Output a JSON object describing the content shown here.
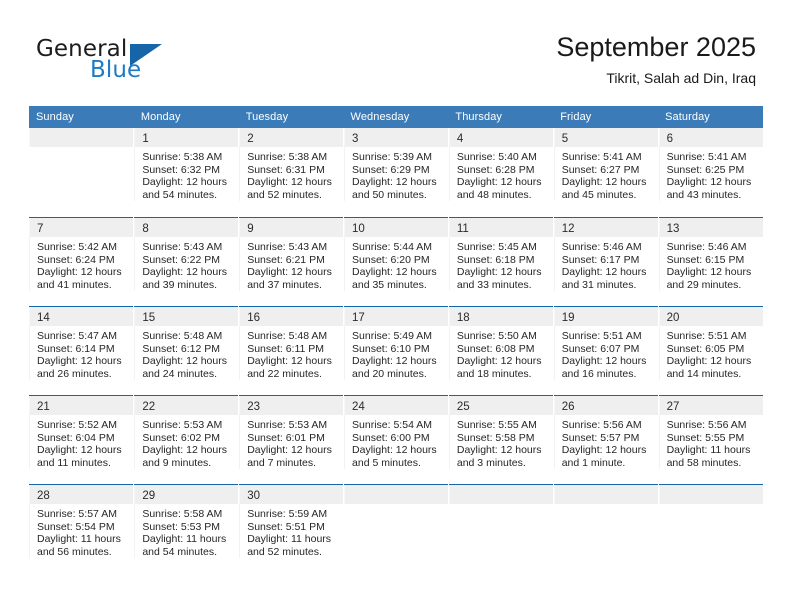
{
  "brand": {
    "name_part1": "General",
    "name_part2": "Blue",
    "logo_icon": "triangle-icon"
  },
  "header": {
    "month_title": "September 2025",
    "location": "Tikrit, Salah ad Din, Iraq"
  },
  "colors": {
    "header_blue": "#3b7cb8",
    "accent_blue": "#1565a8",
    "brand_blue": "#1f7ac4",
    "band_gray": "#efefef"
  },
  "weekday_headers": [
    "Sunday",
    "Monday",
    "Tuesday",
    "Wednesday",
    "Thursday",
    "Friday",
    "Saturday"
  ],
  "labels": {
    "sunrise_prefix": "Sunrise: ",
    "sunset_prefix": "Sunset: ",
    "daylight_prefix": "Daylight: "
  },
  "weeks": [
    [
      {
        "day": "",
        "sunrise": "",
        "sunset": "",
        "daylight": "",
        "empty": true
      },
      {
        "day": "1",
        "sunrise": "Sunrise: 5:38 AM",
        "sunset": "Sunset: 6:32 PM",
        "daylight": "Daylight: 12 hours and 54 minutes."
      },
      {
        "day": "2",
        "sunrise": "Sunrise: 5:38 AM",
        "sunset": "Sunset: 6:31 PM",
        "daylight": "Daylight: 12 hours and 52 minutes."
      },
      {
        "day": "3",
        "sunrise": "Sunrise: 5:39 AM",
        "sunset": "Sunset: 6:29 PM",
        "daylight": "Daylight: 12 hours and 50 minutes."
      },
      {
        "day": "4",
        "sunrise": "Sunrise: 5:40 AM",
        "sunset": "Sunset: 6:28 PM",
        "daylight": "Daylight: 12 hours and 48 minutes."
      },
      {
        "day": "5",
        "sunrise": "Sunrise: 5:41 AM",
        "sunset": "Sunset: 6:27 PM",
        "daylight": "Daylight: 12 hours and 45 minutes."
      },
      {
        "day": "6",
        "sunrise": "Sunrise: 5:41 AM",
        "sunset": "Sunset: 6:25 PM",
        "daylight": "Daylight: 12 hours and 43 minutes."
      }
    ],
    [
      {
        "day": "7",
        "sunrise": "Sunrise: 5:42 AM",
        "sunset": "Sunset: 6:24 PM",
        "daylight": "Daylight: 12 hours and 41 minutes."
      },
      {
        "day": "8",
        "sunrise": "Sunrise: 5:43 AM",
        "sunset": "Sunset: 6:22 PM",
        "daylight": "Daylight: 12 hours and 39 minutes."
      },
      {
        "day": "9",
        "sunrise": "Sunrise: 5:43 AM",
        "sunset": "Sunset: 6:21 PM",
        "daylight": "Daylight: 12 hours and 37 minutes."
      },
      {
        "day": "10",
        "sunrise": "Sunrise: 5:44 AM",
        "sunset": "Sunset: 6:20 PM",
        "daylight": "Daylight: 12 hours and 35 minutes."
      },
      {
        "day": "11",
        "sunrise": "Sunrise: 5:45 AM",
        "sunset": "Sunset: 6:18 PM",
        "daylight": "Daylight: 12 hours and 33 minutes."
      },
      {
        "day": "12",
        "sunrise": "Sunrise: 5:46 AM",
        "sunset": "Sunset: 6:17 PM",
        "daylight": "Daylight: 12 hours and 31 minutes."
      },
      {
        "day": "13",
        "sunrise": "Sunrise: 5:46 AM",
        "sunset": "Sunset: 6:15 PM",
        "daylight": "Daylight: 12 hours and 29 minutes."
      }
    ],
    [
      {
        "day": "14",
        "sunrise": "Sunrise: 5:47 AM",
        "sunset": "Sunset: 6:14 PM",
        "daylight": "Daylight: 12 hours and 26 minutes."
      },
      {
        "day": "15",
        "sunrise": "Sunrise: 5:48 AM",
        "sunset": "Sunset: 6:12 PM",
        "daylight": "Daylight: 12 hours and 24 minutes."
      },
      {
        "day": "16",
        "sunrise": "Sunrise: 5:48 AM",
        "sunset": "Sunset: 6:11 PM",
        "daylight": "Daylight: 12 hours and 22 minutes."
      },
      {
        "day": "17",
        "sunrise": "Sunrise: 5:49 AM",
        "sunset": "Sunset: 6:10 PM",
        "daylight": "Daylight: 12 hours and 20 minutes."
      },
      {
        "day": "18",
        "sunrise": "Sunrise: 5:50 AM",
        "sunset": "Sunset: 6:08 PM",
        "daylight": "Daylight: 12 hours and 18 minutes."
      },
      {
        "day": "19",
        "sunrise": "Sunrise: 5:51 AM",
        "sunset": "Sunset: 6:07 PM",
        "daylight": "Daylight: 12 hours and 16 minutes."
      },
      {
        "day": "20",
        "sunrise": "Sunrise: 5:51 AM",
        "sunset": "Sunset: 6:05 PM",
        "daylight": "Daylight: 12 hours and 14 minutes."
      }
    ],
    [
      {
        "day": "21",
        "sunrise": "Sunrise: 5:52 AM",
        "sunset": "Sunset: 6:04 PM",
        "daylight": "Daylight: 12 hours and 11 minutes."
      },
      {
        "day": "22",
        "sunrise": "Sunrise: 5:53 AM",
        "sunset": "Sunset: 6:02 PM",
        "daylight": "Daylight: 12 hours and 9 minutes."
      },
      {
        "day": "23",
        "sunrise": "Sunrise: 5:53 AM",
        "sunset": "Sunset: 6:01 PM",
        "daylight": "Daylight: 12 hours and 7 minutes."
      },
      {
        "day": "24",
        "sunrise": "Sunrise: 5:54 AM",
        "sunset": "Sunset: 6:00 PM",
        "daylight": "Daylight: 12 hours and 5 minutes."
      },
      {
        "day": "25",
        "sunrise": "Sunrise: 5:55 AM",
        "sunset": "Sunset: 5:58 PM",
        "daylight": "Daylight: 12 hours and 3 minutes."
      },
      {
        "day": "26",
        "sunrise": "Sunrise: 5:56 AM",
        "sunset": "Sunset: 5:57 PM",
        "daylight": "Daylight: 12 hours and 1 minute."
      },
      {
        "day": "27",
        "sunrise": "Sunrise: 5:56 AM",
        "sunset": "Sunset: 5:55 PM",
        "daylight": "Daylight: 11 hours and 58 minutes."
      }
    ],
    [
      {
        "day": "28",
        "sunrise": "Sunrise: 5:57 AM",
        "sunset": "Sunset: 5:54 PM",
        "daylight": "Daylight: 11 hours and 56 minutes."
      },
      {
        "day": "29",
        "sunrise": "Sunrise: 5:58 AM",
        "sunset": "Sunset: 5:53 PM",
        "daylight": "Daylight: 11 hours and 54 minutes."
      },
      {
        "day": "30",
        "sunrise": "Sunrise: 5:59 AM",
        "sunset": "Sunset: 5:51 PM",
        "daylight": "Daylight: 11 hours and 52 minutes."
      },
      {
        "day": "",
        "sunrise": "",
        "sunset": "",
        "daylight": "",
        "empty": true
      },
      {
        "day": "",
        "sunrise": "",
        "sunset": "",
        "daylight": "",
        "empty": true
      },
      {
        "day": "",
        "sunrise": "",
        "sunset": "",
        "daylight": "",
        "empty": true
      },
      {
        "day": "",
        "sunrise": "",
        "sunset": "",
        "daylight": "",
        "empty": true
      }
    ]
  ]
}
